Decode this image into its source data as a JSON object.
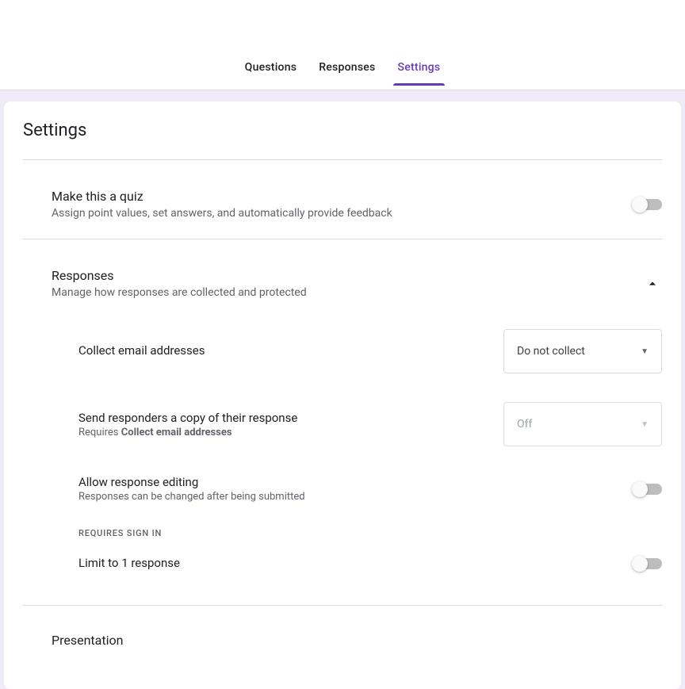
{
  "tabs": {
    "questions": "Questions",
    "responses": "Responses",
    "settings": "Settings"
  },
  "page": {
    "title": "Settings"
  },
  "quiz": {
    "title": "Make this a quiz",
    "subtitle": "Assign point values, set answers, and automatically provide feedback"
  },
  "responses": {
    "title": "Responses",
    "subtitle": "Manage how responses are collected and protected",
    "collect": {
      "label": "Collect email addresses",
      "value": "Do not collect"
    },
    "sendCopy": {
      "label": "Send responders a copy of their response",
      "hintPrefix": "Requires ",
      "hintBold": "Collect email addresses",
      "value": "Off"
    },
    "allowEdit": {
      "label": "Allow response editing",
      "hint": "Responses can be changed after being submitted"
    },
    "signInGroup": "Requires sign in",
    "limit": {
      "label": "Limit to 1 response"
    }
  },
  "presentation": {
    "title": "Presentation"
  }
}
